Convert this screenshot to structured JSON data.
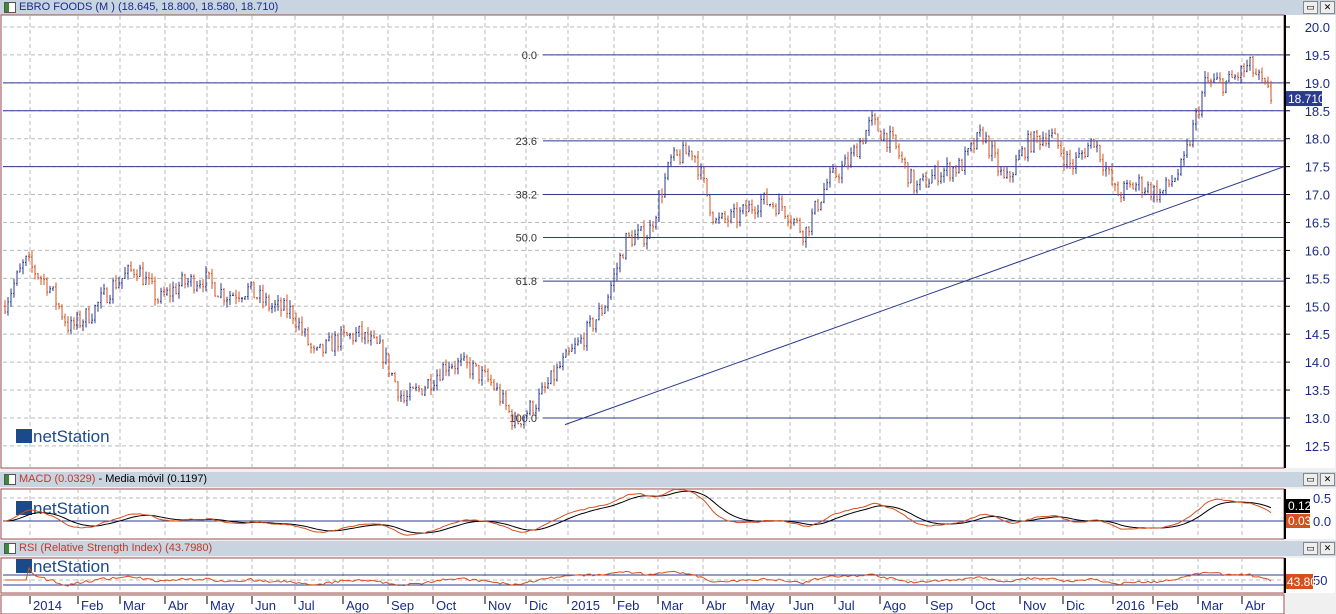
{
  "window": {
    "title": "EBRO FOODS (M ) (18.645, 18.800, 18.580, 18.710)",
    "maximize": "▭",
    "close": "✕"
  },
  "macd": {
    "title_macd": "MACD (0.0329)",
    "separator": " - ",
    "title_ma": "Media móvil (0.1197)",
    "badge_macd": "0.12",
    "badge_signal": "0.03",
    "ticks": [
      "0.5",
      "0.0"
    ]
  },
  "rsi": {
    "title": "RSI (Relative Strength Index) (43.7980)",
    "badge": "43.80",
    "ticks": [
      "50"
    ]
  },
  "logo": "netStation",
  "colors": {
    "up": "#2b3a8f",
    "down": "#d4501e",
    "line": "#2b3a8f",
    "badge": "#2b3a8f",
    "macd": "#d4501e",
    "signal": "#000000"
  },
  "chart_data": {
    "type": "ohlc",
    "title": "EBRO FOODS (M )",
    "last": {
      "open": 18.645,
      "high": 18.8,
      "low": 18.58,
      "close": 18.71,
      "label": "18.710"
    },
    "ylim": [
      12.2,
      20.2
    ],
    "yticks": [
      "20.0",
      "19.5",
      "19.0",
      "18.5",
      "18.0",
      "17.5",
      "17.0",
      "16.5",
      "16.0",
      "15.5",
      "15.0",
      "14.5",
      "14.0",
      "13.5",
      "13.0",
      "12.5"
    ],
    "xticks": [
      "2014",
      "Feb",
      "Mar",
      "Abr",
      "May",
      "Jun",
      "Jul",
      "Ago",
      "Sep",
      "Oct",
      "Nov",
      "Dic",
      "2015",
      "Feb",
      "Mar",
      "Abr",
      "May",
      "Jun",
      "Jul",
      "Ago",
      "Sep",
      "Oct",
      "Nov",
      "Dic",
      "2016",
      "Feb",
      "Mar",
      "Abr"
    ],
    "close_path_by_half_month": [
      15.0,
      15.8,
      15.4,
      14.6,
      14.9,
      15.4,
      15.7,
      15.1,
      15.4,
      15.5,
      15.2,
      15.3,
      15.0,
      14.9,
      14.1,
      14.4,
      14.5,
      14.2,
      13.3,
      13.6,
      14.0,
      13.9,
      13.6,
      12.9,
      13.3,
      13.9,
      14.4,
      15.0,
      16.2,
      16.3,
      17.6,
      17.8,
      16.5,
      16.6,
      16.9,
      16.8,
      16.3,
      17.2,
      17.6,
      18.3,
      17.9,
      17.1,
      17.4,
      17.5,
      18.1,
      17.2,
      17.9,
      18.1,
      17.5,
      18.0,
      17.0,
      17.2,
      17.0,
      17.5,
      19.0,
      19.0,
      19.3,
      18.71
    ],
    "horizontal_levels": [
      19.0,
      18.5,
      17.5
    ],
    "fibonacci": [
      {
        "label": "0.0",
        "price": 19.5
      },
      {
        "label": "23.6",
        "price": 17.96
      },
      {
        "label": "38.2",
        "price": 17.0
      },
      {
        "label": "50.0",
        "price": 16.23
      },
      {
        "label": "61.8",
        "price": 15.45
      },
      {
        "label": "100.0",
        "price": 13.0
      }
    ],
    "trendline": {
      "from": {
        "date": "2015-01",
        "price": 12.88
      },
      "to": {
        "date": "2016-04",
        "price": 17.5
      }
    }
  }
}
